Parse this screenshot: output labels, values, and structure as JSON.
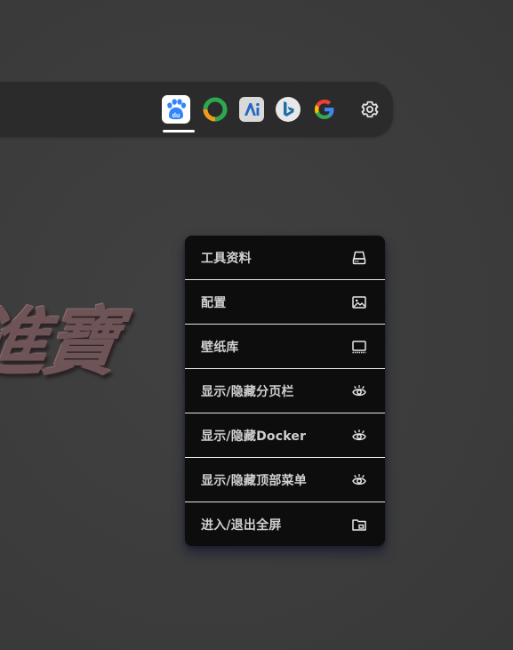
{
  "background": {
    "art_text": "進寶"
  },
  "search_bar": {
    "engines": [
      {
        "name": "Baidu",
        "icon": "baidu-icon",
        "label": "du",
        "selected": true,
        "color": "#3385ff"
      },
      {
        "name": "360",
        "icon": "ring-icon",
        "selected": false
      },
      {
        "name": "AI",
        "icon": "ai-icon",
        "selected": false
      },
      {
        "name": "Bing",
        "icon": "bing-icon",
        "selected": false,
        "color": "#1e6fa8"
      },
      {
        "name": "Google",
        "icon": "google-icon",
        "selected": false
      }
    ],
    "settings_icon": "gear-icon"
  },
  "context_menu": {
    "items": [
      {
        "label": "工具资料",
        "icon": "hard-drive-icon"
      },
      {
        "label": "配置",
        "icon": "image-icon"
      },
      {
        "label": "壁纸库",
        "icon": "monitor-icon"
      },
      {
        "label": "显示/隐藏分页栏",
        "icon": "eye-icon"
      },
      {
        "label": "显示/隐藏Docker",
        "icon": "eye-icon"
      },
      {
        "label": "显示/隐藏顶部菜单",
        "icon": "eye-icon"
      },
      {
        "label": "进入/退出全屏",
        "icon": "fullscreen-icon"
      }
    ]
  },
  "colors": {
    "page_bg": "#3c3c3c",
    "bar_bg": "#2b2b2b",
    "menu_bg": "#0d0d0d",
    "menu_text": "#cfcfcf",
    "divider": "#e6e6e6"
  }
}
